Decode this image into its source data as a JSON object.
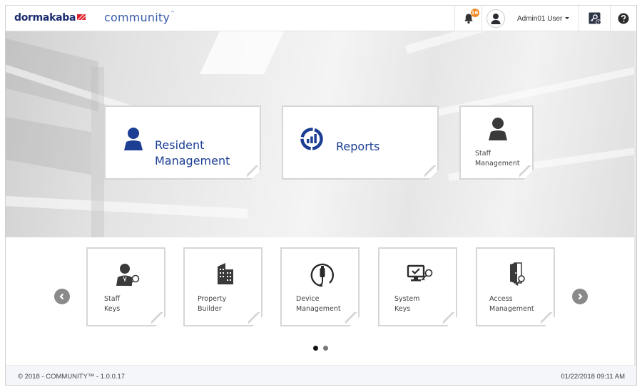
{
  "header": {
    "brand": "dormakaba",
    "product": "community",
    "product_tm": "™",
    "notifications": {
      "icon": "bell-icon",
      "count": "16"
    },
    "user": {
      "avatar_icon": "user-avatar-icon",
      "name": "Admin01 User"
    },
    "key_info_icon": "key-info-icon",
    "help_icon": "question-circle-icon"
  },
  "colors": {
    "brand_navy": "#1a2a6e",
    "brand_red": "#e0202a",
    "accent_blue": "#1c3f94",
    "badge_orange": "#f08a24",
    "icon_dark": "#333333"
  },
  "primary_tiles": [
    {
      "icon": "person-icon",
      "label_line1": "Resident",
      "label_line2": "Management"
    },
    {
      "icon": "reports-chart-icon",
      "label_line1": "Reports",
      "label_line2": ""
    },
    {
      "icon": "person-icon",
      "label_line1": "Staff",
      "label_line2": "Management"
    }
  ],
  "carousel": {
    "prev_icon": "chevron-left-icon",
    "next_icon": "chevron-right-icon",
    "tiles": [
      {
        "icon": "staff-key-icon",
        "label_line1": "Staff",
        "label_line2": "Keys"
      },
      {
        "icon": "building-icon",
        "label_line1": "Property",
        "label_line2": "Builder"
      },
      {
        "icon": "usb-device-icon",
        "label_line1": "Device",
        "label_line2": "Management"
      },
      {
        "icon": "monitor-key-icon",
        "label_line1": "System",
        "label_line2": "Keys"
      },
      {
        "icon": "door-key-icon",
        "label_line1": "Access",
        "label_line2": "Management"
      }
    ],
    "pages": 2,
    "active_page": 1
  },
  "footer": {
    "copyright": "© 2018 - COMMUNITY™ - 1.0.0.17",
    "datetime": "01/22/2018 09:11 AM"
  }
}
